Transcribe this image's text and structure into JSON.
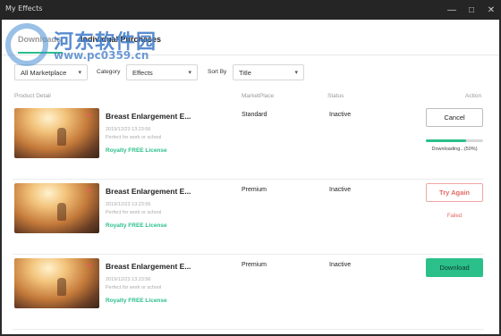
{
  "window": {
    "title": "My Effects",
    "minimize": "—",
    "maximize": "□",
    "close": "✕"
  },
  "watermark": {
    "text_cn": "河东软件园",
    "url": "www.pc0359.cn"
  },
  "tabs": [
    {
      "label": "Downloads",
      "active": true
    },
    {
      "label": "Individual Purchases",
      "active": false
    }
  ],
  "filters": {
    "marketplace": {
      "value": "All Marketplace"
    },
    "category": {
      "label": "Category",
      "value": "Effects"
    },
    "sort": {
      "label": "Sort By",
      "value": "Title"
    }
  },
  "columns": {
    "product": "Product Detail",
    "marketplace": "MarketPlace",
    "status": "Status",
    "action": "Action"
  },
  "items": [
    {
      "name": "Breast Enlargement E...",
      "date": "2019/12/23 13:23:56",
      "description": "Perfect for work or school",
      "license": "Royalty FREE License",
      "marketplace": "Standard",
      "status": "Inactive",
      "action": "Cancel",
      "progress": 0.7,
      "progress_text": "Downloading...(50%)"
    },
    {
      "name": "Breast Enlargement E...",
      "date": "2019/12/23 13:23:56",
      "description": "Perfect for work or school",
      "license": "Royalty FREE License",
      "marketplace": "Premium",
      "status": "Inactive",
      "action": "Try Again",
      "note": "Failed"
    },
    {
      "name": "Breast Enlargement E...",
      "date": "2019/12/23 13:23:56",
      "description": "Perfect for work or school",
      "license": "Royalty FREE License",
      "marketplace": "Premium",
      "status": "Inactive",
      "action": "Download"
    }
  ],
  "colors": {
    "accent": "#2bbf8a",
    "error": "#e56a63",
    "titlebar": "#252525"
  }
}
